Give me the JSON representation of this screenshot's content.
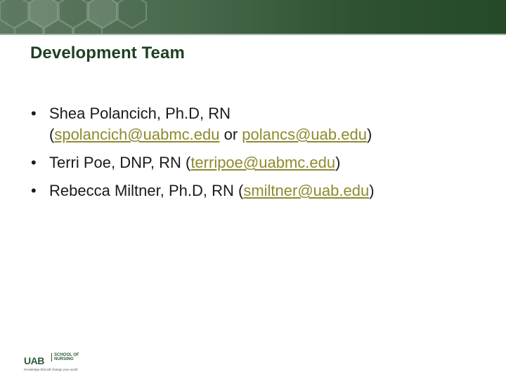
{
  "slide": {
    "title": "Development Team",
    "colors": {
      "banner": "#2e5233",
      "title": "#1f3f24",
      "link": "#8e8a2e"
    }
  },
  "bullets": [
    {
      "bullet": "•",
      "text1": "Shea Polancich, Ph.D, RN",
      "open": "(",
      "email1": "spolancich@uabmc.edu",
      "middle": " or ",
      "email2": "polancs@uab.edu",
      "close": ")"
    },
    {
      "bullet": "•",
      "text": "Terri Poe, DNP, RN (",
      "email": "terripoe@uabmc.edu",
      "close": ")"
    },
    {
      "bullet": "•",
      "text": "Rebecca Miltner, Ph.D, RN (",
      "email": "smiltner@uab.edu",
      "close": ")"
    }
  ],
  "logo": {
    "uab": "UAB",
    "school_line1": "SCHOOL OF",
    "school_line2": "NURSING",
    "tagline": "Knowledge that will change your world"
  }
}
